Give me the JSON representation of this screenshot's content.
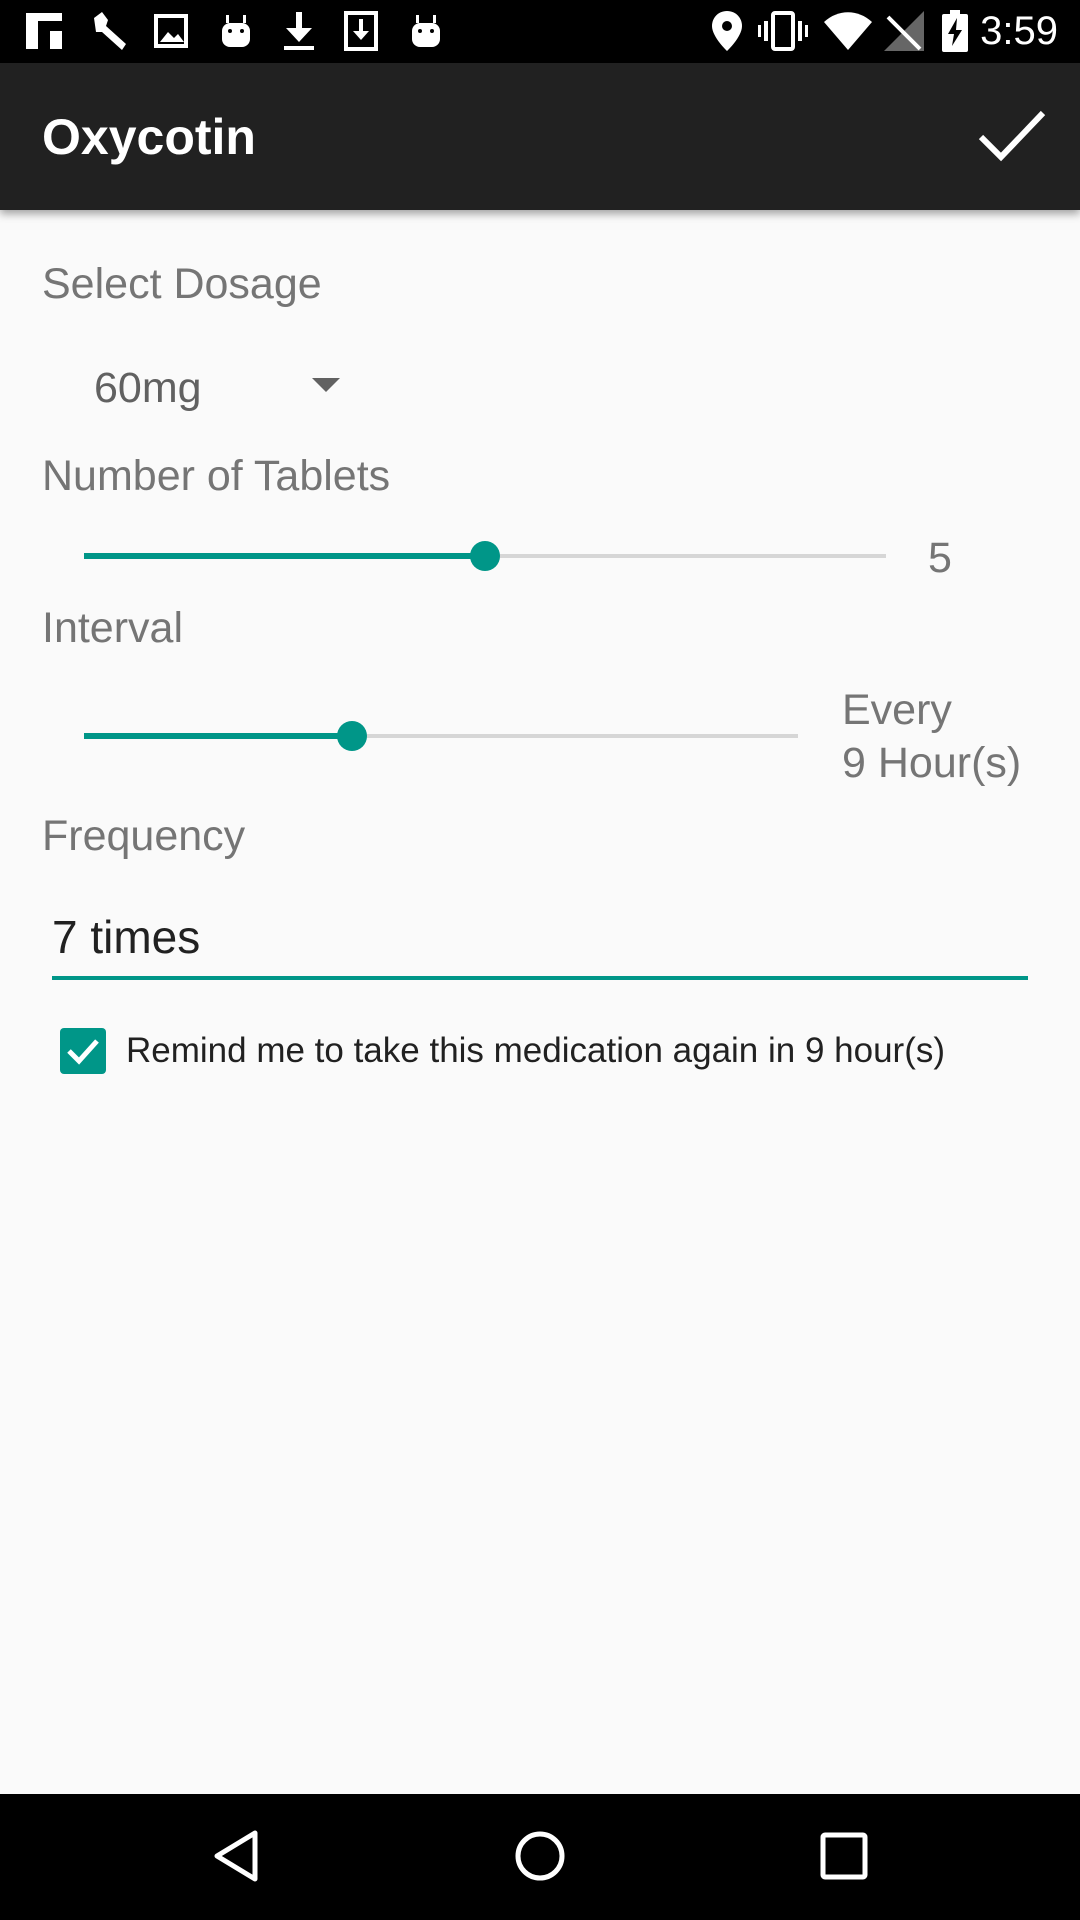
{
  "status_bar": {
    "time": "3:59",
    "icons": [
      "flipboard-icon",
      "wrench-icon",
      "image-icon",
      "android-icon",
      "download-icon",
      "download-box-icon",
      "android-icon",
      "location-icon",
      "vibrate-icon",
      "wifi-icon",
      "no-signal-icon",
      "battery-charging-icon"
    ]
  },
  "toolbar": {
    "title": "Oxycotin",
    "confirm_icon": "check-icon"
  },
  "dosage": {
    "label": "Select Dosage",
    "selected": "60mg"
  },
  "tablets": {
    "label": "Number of Tablets",
    "value": "5",
    "fraction": 0.5
  },
  "interval": {
    "label": "Interval",
    "value_line1": "Every",
    "value_line2": "9 Hour(s)",
    "fraction": 0.375
  },
  "frequency": {
    "label": "Frequency",
    "value": "7 times"
  },
  "reminder": {
    "checked": true,
    "label": "Remind me to take this medication again in 9 hour(s)"
  },
  "nav": {
    "back_icon": "back-triangle-icon",
    "home_icon": "home-circle-icon",
    "recents_icon": "recents-square-icon"
  },
  "colors": {
    "accent": "#009688",
    "toolbar": "#212121",
    "background": "#fafafa"
  }
}
